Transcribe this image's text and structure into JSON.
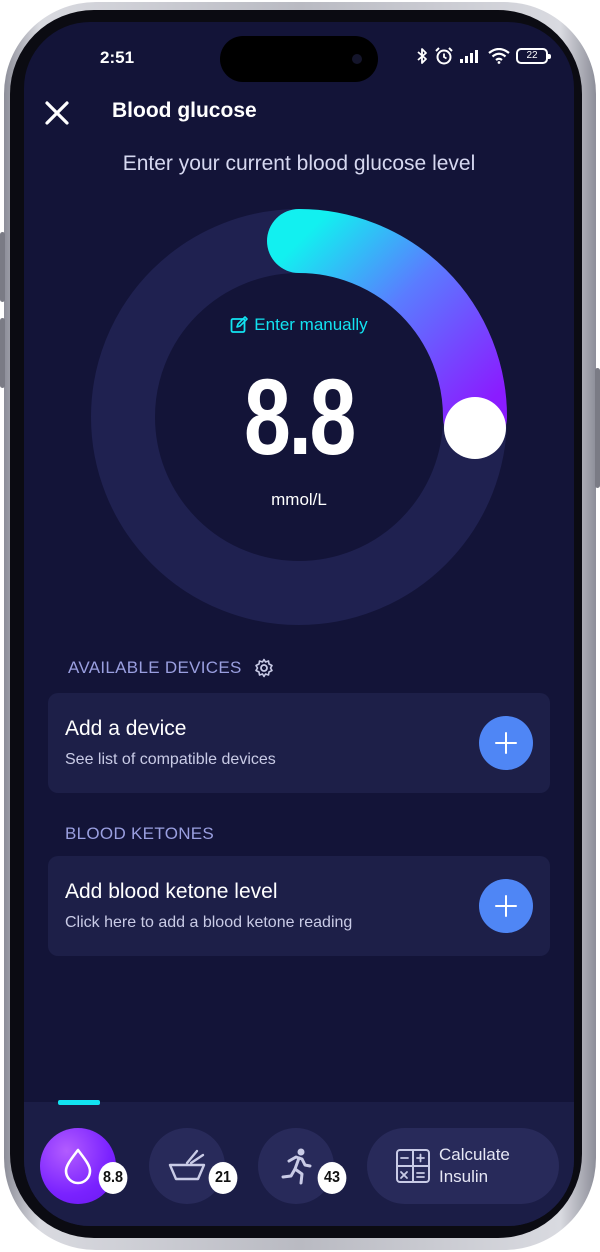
{
  "status_bar": {
    "time": "2:51",
    "battery": "22",
    "icons": [
      "bluetooth-icon",
      "alarm-icon",
      "signal-icon",
      "wifi-icon",
      "battery-icon"
    ]
  },
  "header": {
    "title": "Blood glucose",
    "close_icon": "close-icon"
  },
  "subtitle": "Enter your current blood glucose level",
  "gauge": {
    "enter_manually": "Enter manually",
    "value": "8.8",
    "unit": "mmol/L",
    "colors": {
      "track": "#1f2150",
      "start": "#12f0f0",
      "end": "#8a1cff",
      "knob": "#ffffff"
    }
  },
  "devices": {
    "section_label": "AVAILABLE DEVICES",
    "card_title": "Add a device",
    "card_sub": "See list of compatible devices"
  },
  "ketones": {
    "section_label": "BLOOD KETONES",
    "card_title": "Add blood ketone level",
    "card_sub": "Click here to add a blood ketone reading"
  },
  "bottom_tabs": {
    "glucose_badge": "8.8",
    "food_badge": "21",
    "activity_badge": "43",
    "calculate_label": "Calculate Insulin"
  },
  "colors": {
    "background": "#131438",
    "card": "#1d1f48",
    "accent_cyan": "#12e3f1",
    "plus_button": "#4f86f5",
    "section_label": "#9a9fe0"
  }
}
